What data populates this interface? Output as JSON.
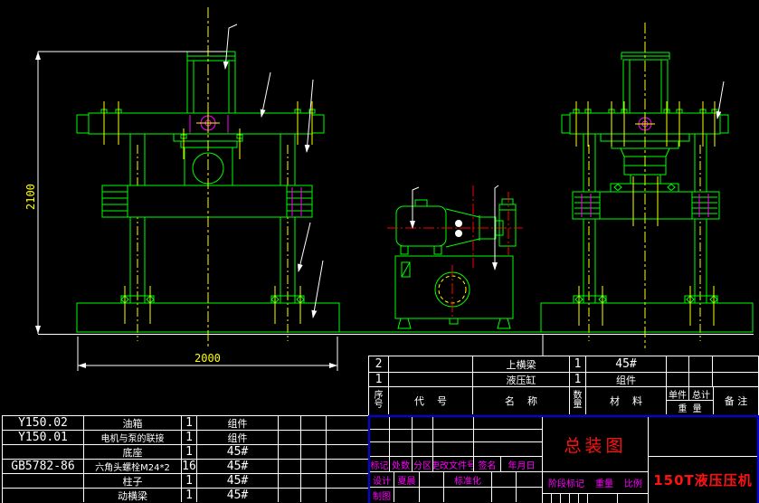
{
  "drawing": {
    "dim_height": "2100",
    "dim_width": "2000"
  },
  "bom_upper": {
    "rows": [
      {
        "seq": "2",
        "code": "",
        "name": "上横梁",
        "qty": "1",
        "material": "45#",
        "unit_w": "",
        "total_w": "",
        "remark": ""
      },
      {
        "seq": "1",
        "code": "",
        "name": "液压缸",
        "qty": "1",
        "material": "组件",
        "unit_w": "",
        "total_w": "",
        "remark": ""
      }
    ],
    "header": {
      "seq_top": "序",
      "seq_bottom": "号",
      "code": "代    号",
      "name": "名    称",
      "qty_top": "数",
      "qty_bottom": "量",
      "material": "材    料",
      "unit": "单件",
      "total": "总计",
      "weight": "重  量",
      "remark": "备 注"
    }
  },
  "bom_left": {
    "rows": [
      {
        "code": "Y150.02",
        "name": "油箱",
        "qty": "1",
        "material": "组件"
      },
      {
        "code": "Y150.01",
        "name": "电机与泵的联接",
        "qty": "1",
        "material": "组件"
      },
      {
        "code": "",
        "name": "底座",
        "qty": "1",
        "material": "45#"
      },
      {
        "code": "GB5782-86",
        "name": "六角头螺栓M24*2",
        "qty": "16",
        "material": "45#"
      },
      {
        "code": "",
        "name": "柱子",
        "qty": "1",
        "material": "45#"
      },
      {
        "code": "",
        "name": "动横梁",
        "qty": "1",
        "material": "45#"
      }
    ]
  },
  "title_block": {
    "drawing_title": "总装图",
    "product_name": "150T液压压机",
    "revision_header": {
      "mark": "标记",
      "count": "处数",
      "zone": "分区",
      "doc_no": "更改文件号",
      "sign": "签名",
      "date": "年月日"
    },
    "design_label": "设计",
    "designer": "夏晨",
    "standardization_label": "标准化",
    "draft_label": "制图",
    "stage_label": "阶段标记",
    "weight_label": "重量",
    "scale_label": "比例"
  },
  "colors": {
    "outline_green": "#00ff00",
    "centerline_yellow": "#ffff00",
    "annotation_white": "#ffffff",
    "section_magenta": "#ff00ff",
    "axis_red": "#ff0000",
    "frame_blue": "#0000ee",
    "title_red": "#ff1111"
  }
}
